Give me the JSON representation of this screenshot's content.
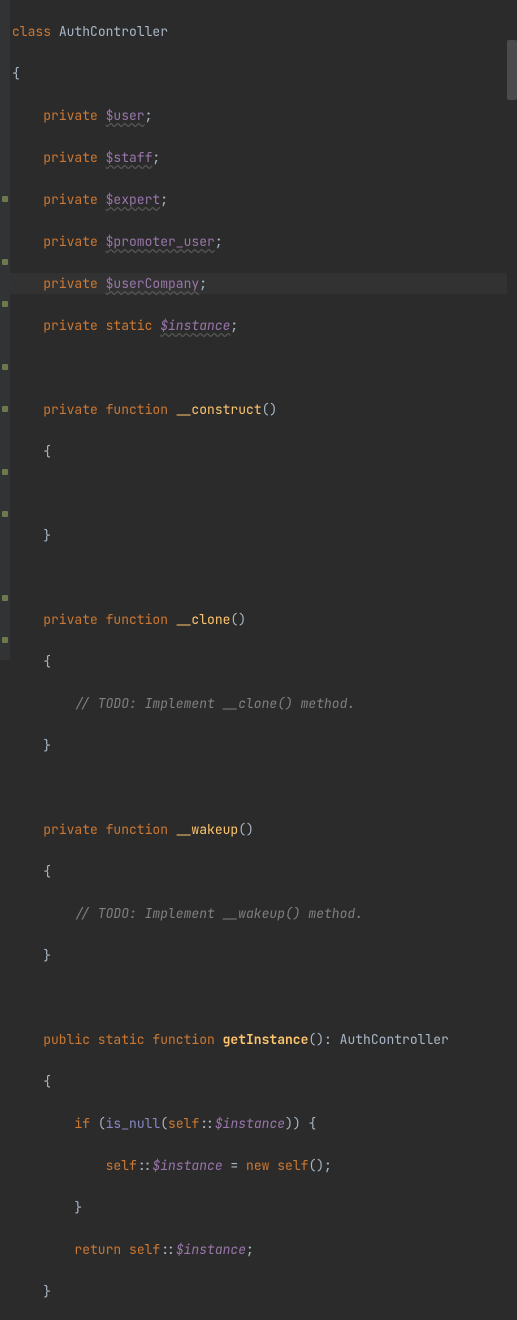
{
  "code": {
    "l01_kw": "class ",
    "l01_name": "AuthController",
    "l02": "{",
    "l03_mod": "    private ",
    "l03_var": "$user",
    "l03_end": ";",
    "l04_mod": "    private ",
    "l04_var": "$staff",
    "l04_end": ";",
    "l05_mod": "    private ",
    "l05_var": "$expert",
    "l05_end": ";",
    "l06_mod": "    private ",
    "l06_var": "$promoter_user",
    "l06_end": ";",
    "l07_mod": "    private ",
    "l07_var": "$userCompany",
    "l07_end": ";",
    "l08_mod": "    private static ",
    "l08_var": "$instance",
    "l08_end": ";",
    "l10_mod": "    private function ",
    "l10_fn": "__construct",
    "l10_p": "()",
    "l11": "    {",
    "l13": "    }",
    "l15_mod": "    private function ",
    "l15_fn": "__clone",
    "l15_p": "()",
    "l16": "    {",
    "l17_c": "        // TODO: Implement __clone() method.",
    "l18": "    }",
    "l20_mod": "    private function ",
    "l20_fn": "__wakeup",
    "l20_p": "()",
    "l21": "    {",
    "l22_c": "        // TODO: Implement __wakeup() method.",
    "l23": "    }",
    "l25_mod": "    public static function ",
    "l25_fn": "getInstance",
    "l25_p": "()",
    "l25_colon": ": ",
    "l25_ret": "AuthController",
    "l26": "    {",
    "l27_a": "        if ",
    "l27_b": "(",
    "l27_c": "is_null",
    "l27_d": "(",
    "l27_e": "self",
    "l27_f": "::",
    "l27_g": "$instance",
    "l27_h": ")) {",
    "l28_a": "            ",
    "l28_b": "self",
    "l28_c": "::",
    "l28_d": "$instance",
    "l28_e": " = ",
    "l28_f": "new ",
    "l28_g": "self",
    "l28_h": "();",
    "l29": "        }",
    "l30_a": "        return ",
    "l30_b": "self",
    "l30_c": "::",
    "l30_d": "$instance",
    "l30_e": ";",
    "l31": "    }"
  }
}
